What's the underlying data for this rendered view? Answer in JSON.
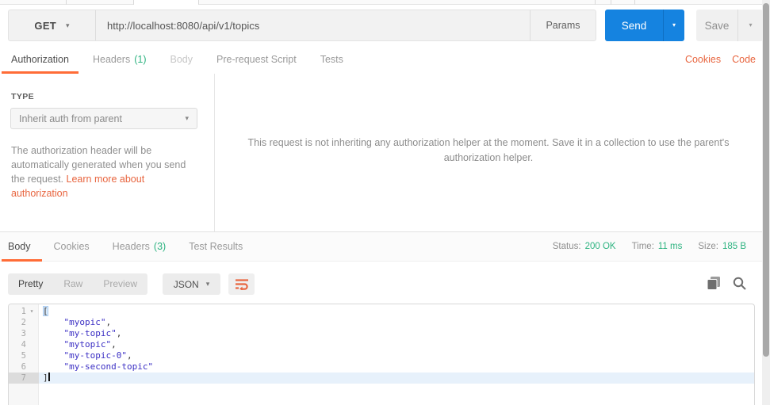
{
  "colors": {
    "accent_orange": "#ff6c37",
    "link_orange": "#e8653f",
    "status_green": "#2db380",
    "send_blue": "#1583e0",
    "json_string_blue": "#3b2fc4"
  },
  "request_bar": {
    "method": "GET",
    "url": "http://localhost:8080/api/v1/topics",
    "params": "Params",
    "send": "Send",
    "save": "Save"
  },
  "request_tabs": {
    "tabs": [
      {
        "label": "Authorization"
      },
      {
        "label": "Headers",
        "count": "(1)"
      },
      {
        "label": "Body"
      },
      {
        "label": "Pre-request Script"
      },
      {
        "label": "Tests"
      }
    ],
    "cookies": "Cookies",
    "code": "Code"
  },
  "authorization": {
    "type_label": "TYPE",
    "type_value": "Inherit auth from parent",
    "help_text": "The authorization header will be automatically generated when you send the request. ",
    "help_link": "Learn more about authorization",
    "helper_message": "This request is not inheriting any authorization helper at the moment. Save it in a collection to use the parent's authorization helper."
  },
  "response_meta": {
    "tabs": [
      {
        "label": "Body"
      },
      {
        "label": "Cookies"
      },
      {
        "label": "Headers",
        "count": "(3)"
      },
      {
        "label": "Test Results"
      }
    ],
    "status_label": "Status:",
    "status_value": "200 OK",
    "time_label": "Time:",
    "time_value": "11 ms",
    "size_label": "Size:",
    "size_value": "185 B"
  },
  "response_toolbar": {
    "modes": [
      "Pretty",
      "Raw",
      "Preview"
    ],
    "format": "JSON"
  },
  "editor": {
    "lines": [
      {
        "n": "1",
        "punct": "["
      },
      {
        "n": "2",
        "pre": "    ",
        "str": "\"myopic\"",
        "punct": ","
      },
      {
        "n": "3",
        "pre": "    ",
        "str": "\"my-topic\"",
        "punct": ","
      },
      {
        "n": "4",
        "pre": "    ",
        "str": "\"mytopic\"",
        "punct": ","
      },
      {
        "n": "5",
        "pre": "    ",
        "str": "\"my-topic-0\"",
        "punct": ","
      },
      {
        "n": "6",
        "pre": "    ",
        "str": "\"my-second-topic\"",
        "punct": ""
      },
      {
        "n": "7",
        "punct": "]"
      }
    ]
  }
}
